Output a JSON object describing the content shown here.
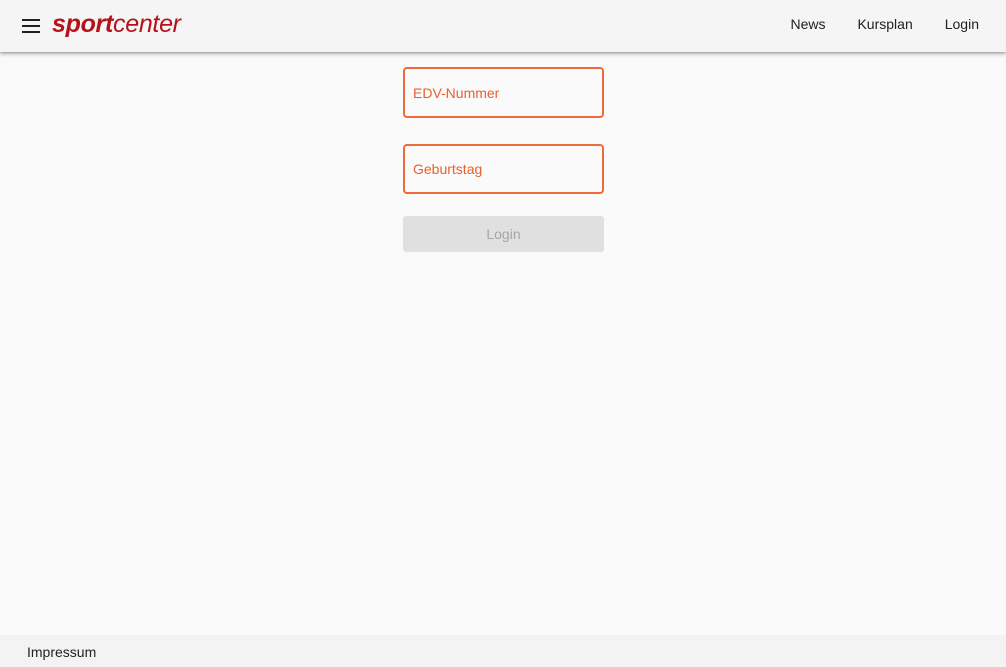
{
  "header": {
    "menu_icon": "hamburger-menu-icon",
    "logo": {
      "bold": "sport",
      "light": "center"
    },
    "nav": [
      {
        "label": "News"
      },
      {
        "label": "Kursplan"
      },
      {
        "label": "Login"
      }
    ]
  },
  "form": {
    "edv_placeholder": "EDV-Nummer",
    "birthday_placeholder": "Geburtstag",
    "login_button": "Login"
  },
  "footer": {
    "impressum": "Impressum"
  },
  "colors": {
    "brand": "#b5121b",
    "accent": "#ee6a3c",
    "button_disabled_bg": "#e0e0e0",
    "button_disabled_text": "#a6a6a6"
  }
}
